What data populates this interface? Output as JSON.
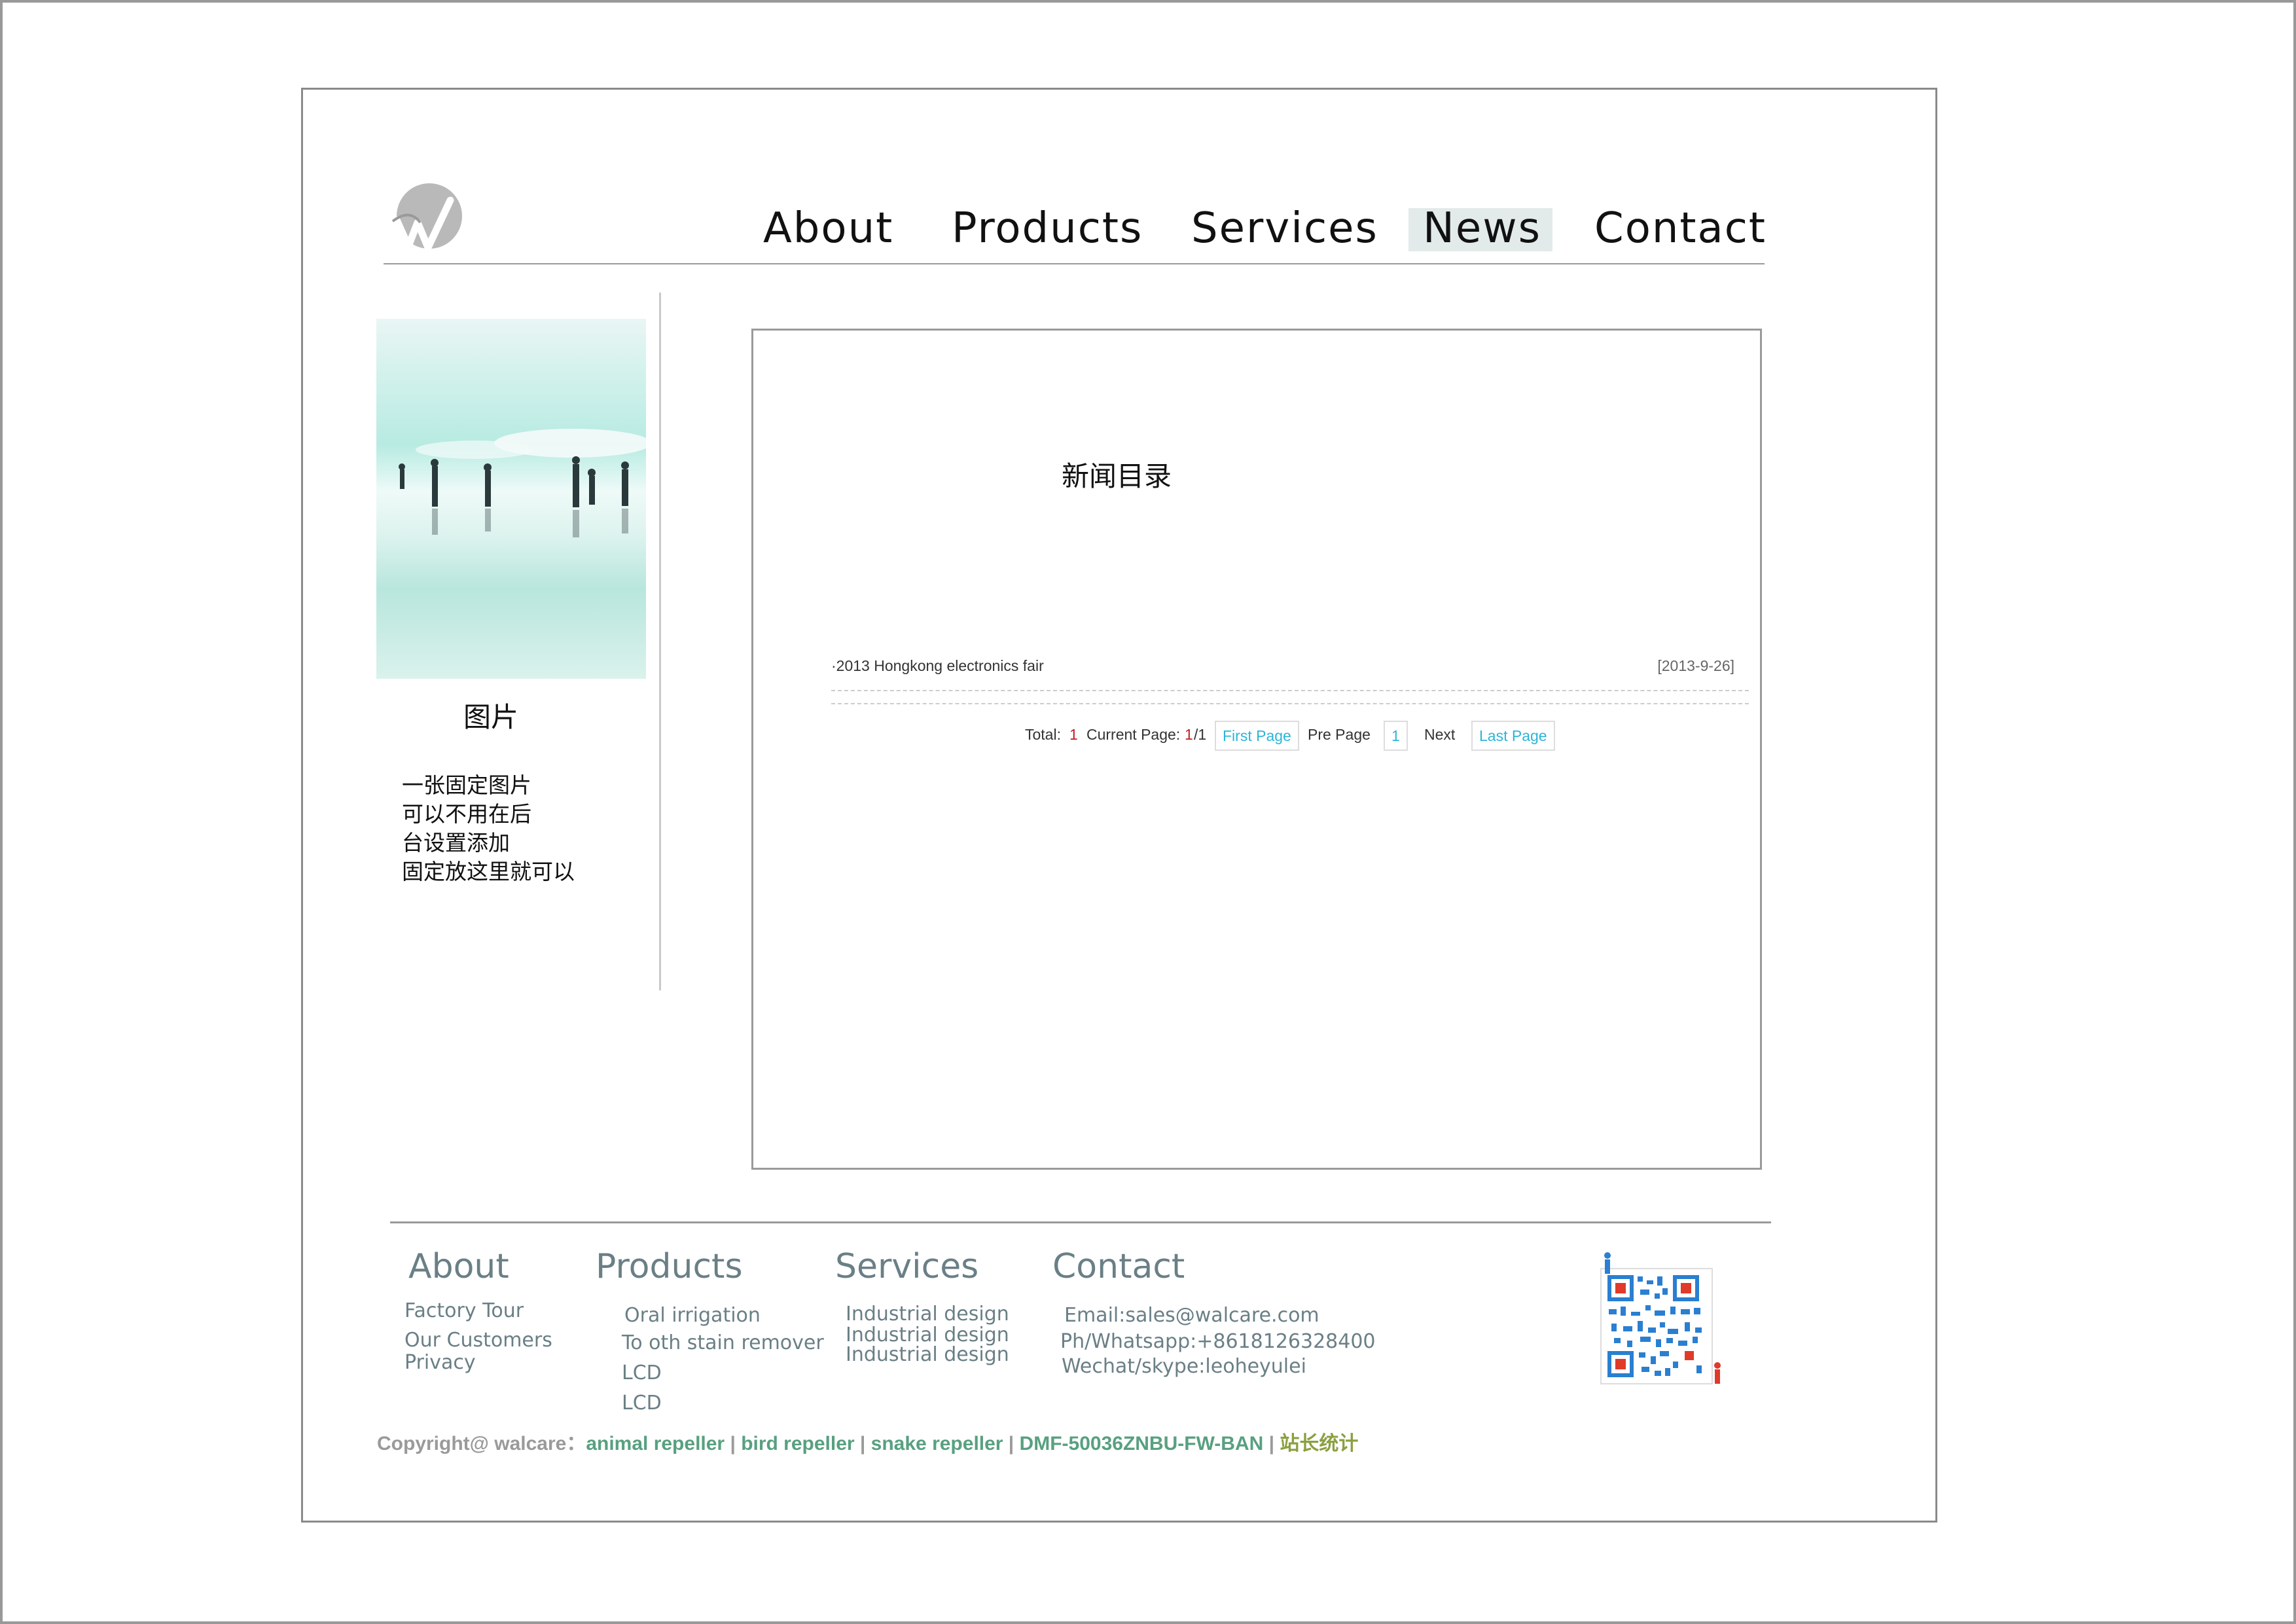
{
  "colors": {
    "nav_active_bg": "#e2eaea",
    "footer_text": "#6a7f86",
    "pager_link": "#2cb5d9",
    "copyright_link": "#58a080",
    "stat_link": "#8aa040"
  },
  "header": {
    "logo_icon": "walcare-w-logo",
    "nav": [
      {
        "label": "About"
      },
      {
        "label": "Products"
      },
      {
        "label": "Services"
      },
      {
        "label": "News",
        "active": true
      },
      {
        "label": "Contact"
      }
    ]
  },
  "sidebar": {
    "photo_icon": "people-on-salt-flat-photo",
    "caption": "图片",
    "description": [
      "一张固定图片",
      "可以不用在后",
      "台设置添加",
      "固定放这里就可以"
    ]
  },
  "main": {
    "title": "新闻目录",
    "news": [
      {
        "title": "·2013 Hongkong electronics fair",
        "date": "[2013-9-26]"
      }
    ],
    "pager": {
      "total_label": "Total:",
      "total": "1",
      "current_label": "Current Page:",
      "current": "1",
      "of": "/1",
      "first": "First Page",
      "prev": "Pre Page",
      "page": "1",
      "next": "Next",
      "last": "Last Page"
    }
  },
  "footer": {
    "about": {
      "heading": "About",
      "links": [
        "Factory Tour",
        "Our Customers",
        "Privacy"
      ]
    },
    "products": {
      "heading": "Products",
      "links": [
        "Oral irrigation",
        "To oth stain remover",
        "LCD",
        "LCD"
      ]
    },
    "services": {
      "heading": "Services",
      "links": [
        "Industrial design",
        "Industrial design",
        "Industrial design"
      ]
    },
    "contact": {
      "heading": "Contact",
      "lines": [
        "Email:sales@walcare.com",
        "Ph/Whatsapp:+8618126328400",
        "Wechat/skype:leoheyulei"
      ]
    },
    "qr_icon": "qr-code-icon",
    "copyright": {
      "prefix": "Copyright@ walcare：",
      "links": [
        "animal repeller",
        "bird repeller",
        "snake repeller",
        "DMF-50036ZNBU-FW-BAN"
      ],
      "separator": " | ",
      "stat": "站长统计"
    }
  }
}
